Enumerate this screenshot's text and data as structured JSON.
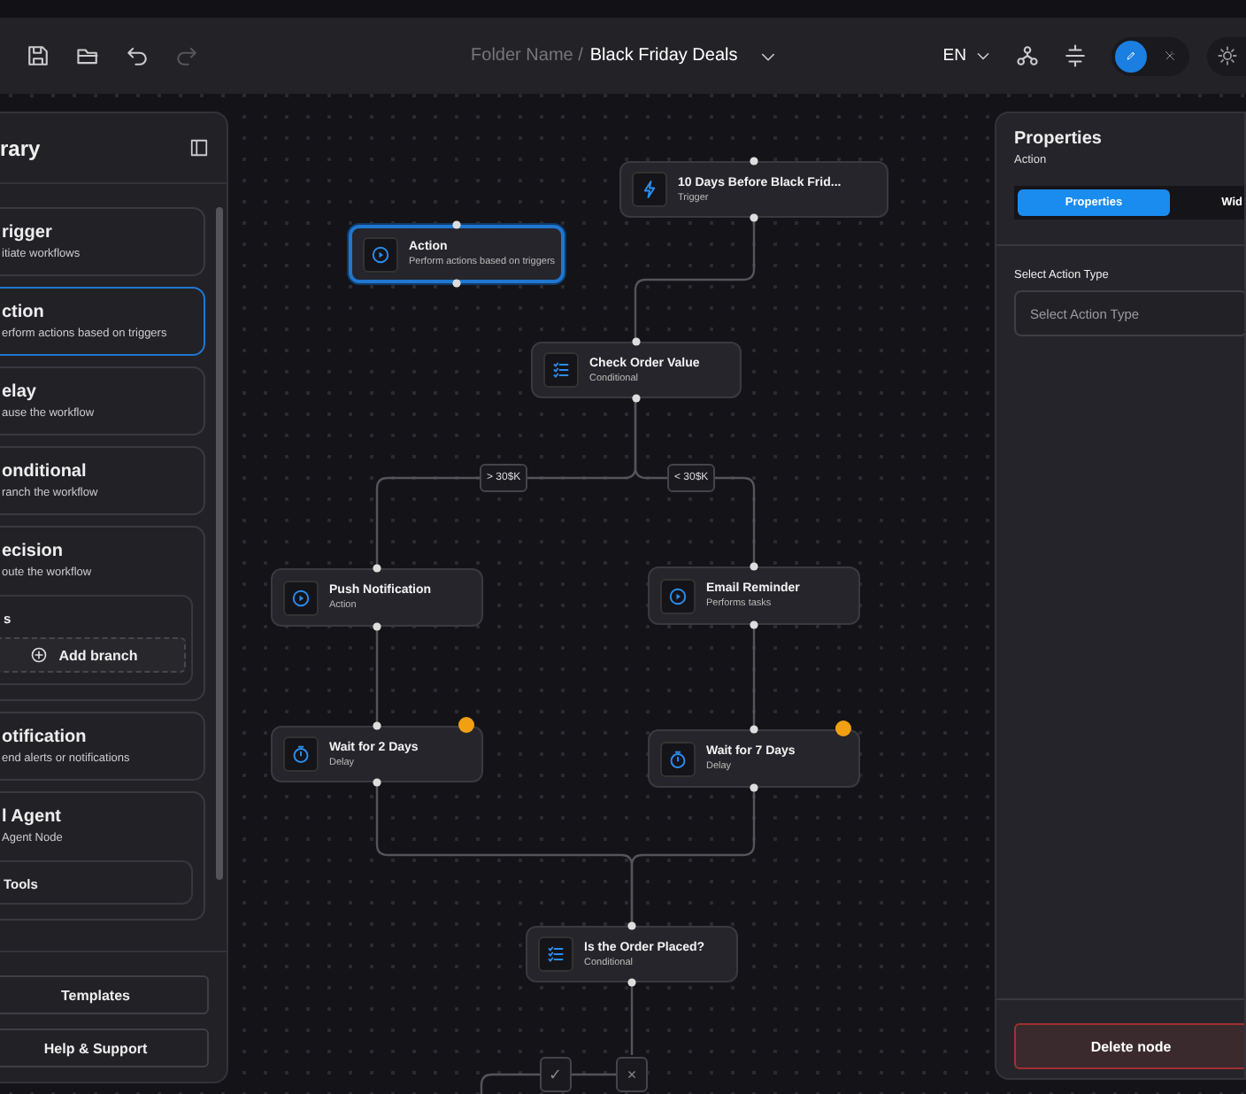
{
  "toolbar": {
    "folder": "Folder Name /",
    "title": "Black Friday Deals",
    "language": "EN",
    "tools": [
      {
        "kind": "save",
        "disabled": false
      },
      {
        "kind": "open",
        "disabled": false
      },
      {
        "kind": "undo",
        "disabled": false
      },
      {
        "kind": "redo",
        "disabled": true
      }
    ],
    "modes": [
      {
        "kind": "edit",
        "selected": true
      },
      {
        "kind": "wand",
        "selected": false
      }
    ]
  },
  "library": {
    "title": "rary",
    "items": [
      {
        "title": "rigger",
        "description": "itiate workflows",
        "selected": false
      },
      {
        "title": "ction",
        "description": "erform actions based on triggers",
        "selected": true
      },
      {
        "title": "elay",
        "description": "ause the workflow",
        "selected": false
      },
      {
        "title": "onditional",
        "description": "ranch the workflow",
        "selected": false
      },
      {
        "title": "ecision",
        "description": "oute the workflow",
        "selected": false,
        "sub_label": "s",
        "sub_button": "Add branch"
      },
      {
        "title": "otification",
        "description": "end alerts or notifications",
        "selected": false
      },
      {
        "title": "l Agent",
        "description": "Agent Node",
        "selected": false,
        "sub_label": "Tools"
      }
    ],
    "footer": [
      "Templates",
      "Help & Support"
    ]
  },
  "canvas": {
    "nodes": [
      {
        "kind": "action",
        "title": "Action",
        "subtitle": "Perform actions based on triggers",
        "selected": true,
        "warning": false
      },
      {
        "kind": "trigger",
        "title": "10 Days Before Black Frid...",
        "subtitle": "Trigger",
        "selected": false,
        "warning": false
      },
      {
        "kind": "conditional",
        "title": "Check Order Value",
        "subtitle": "Conditional",
        "selected": false,
        "warning": false
      },
      {
        "kind": "action",
        "title": "Push Notification",
        "subtitle": "Action",
        "selected": false,
        "warning": false
      },
      {
        "kind": "action",
        "title": "Email Reminder",
        "subtitle": "Performs tasks",
        "selected": false,
        "warning": false
      },
      {
        "kind": "delay",
        "title": "Wait for 2 Days",
        "subtitle": "Delay",
        "selected": false,
        "warning": true
      },
      {
        "kind": "delay",
        "title": "Wait for 7 Days",
        "subtitle": "Delay",
        "selected": false,
        "warning": true
      },
      {
        "kind": "conditional",
        "title": "Is the Order Placed?",
        "subtitle": "Conditional",
        "selected": false,
        "warning": false
      }
    ],
    "edge_labels": [
      "> 30$K",
      "< 30$K"
    ],
    "outcomes": [
      "✓",
      "×"
    ]
  },
  "properties": {
    "title": "Properties",
    "subtitle": "Action",
    "tabs": [
      {
        "label": "Properties",
        "selected": true
      },
      {
        "label": "Wid",
        "selected": false
      }
    ],
    "field_label": "Select Action Type",
    "field_placeholder": "Select Action Type",
    "delete_button": "Delete node"
  }
}
